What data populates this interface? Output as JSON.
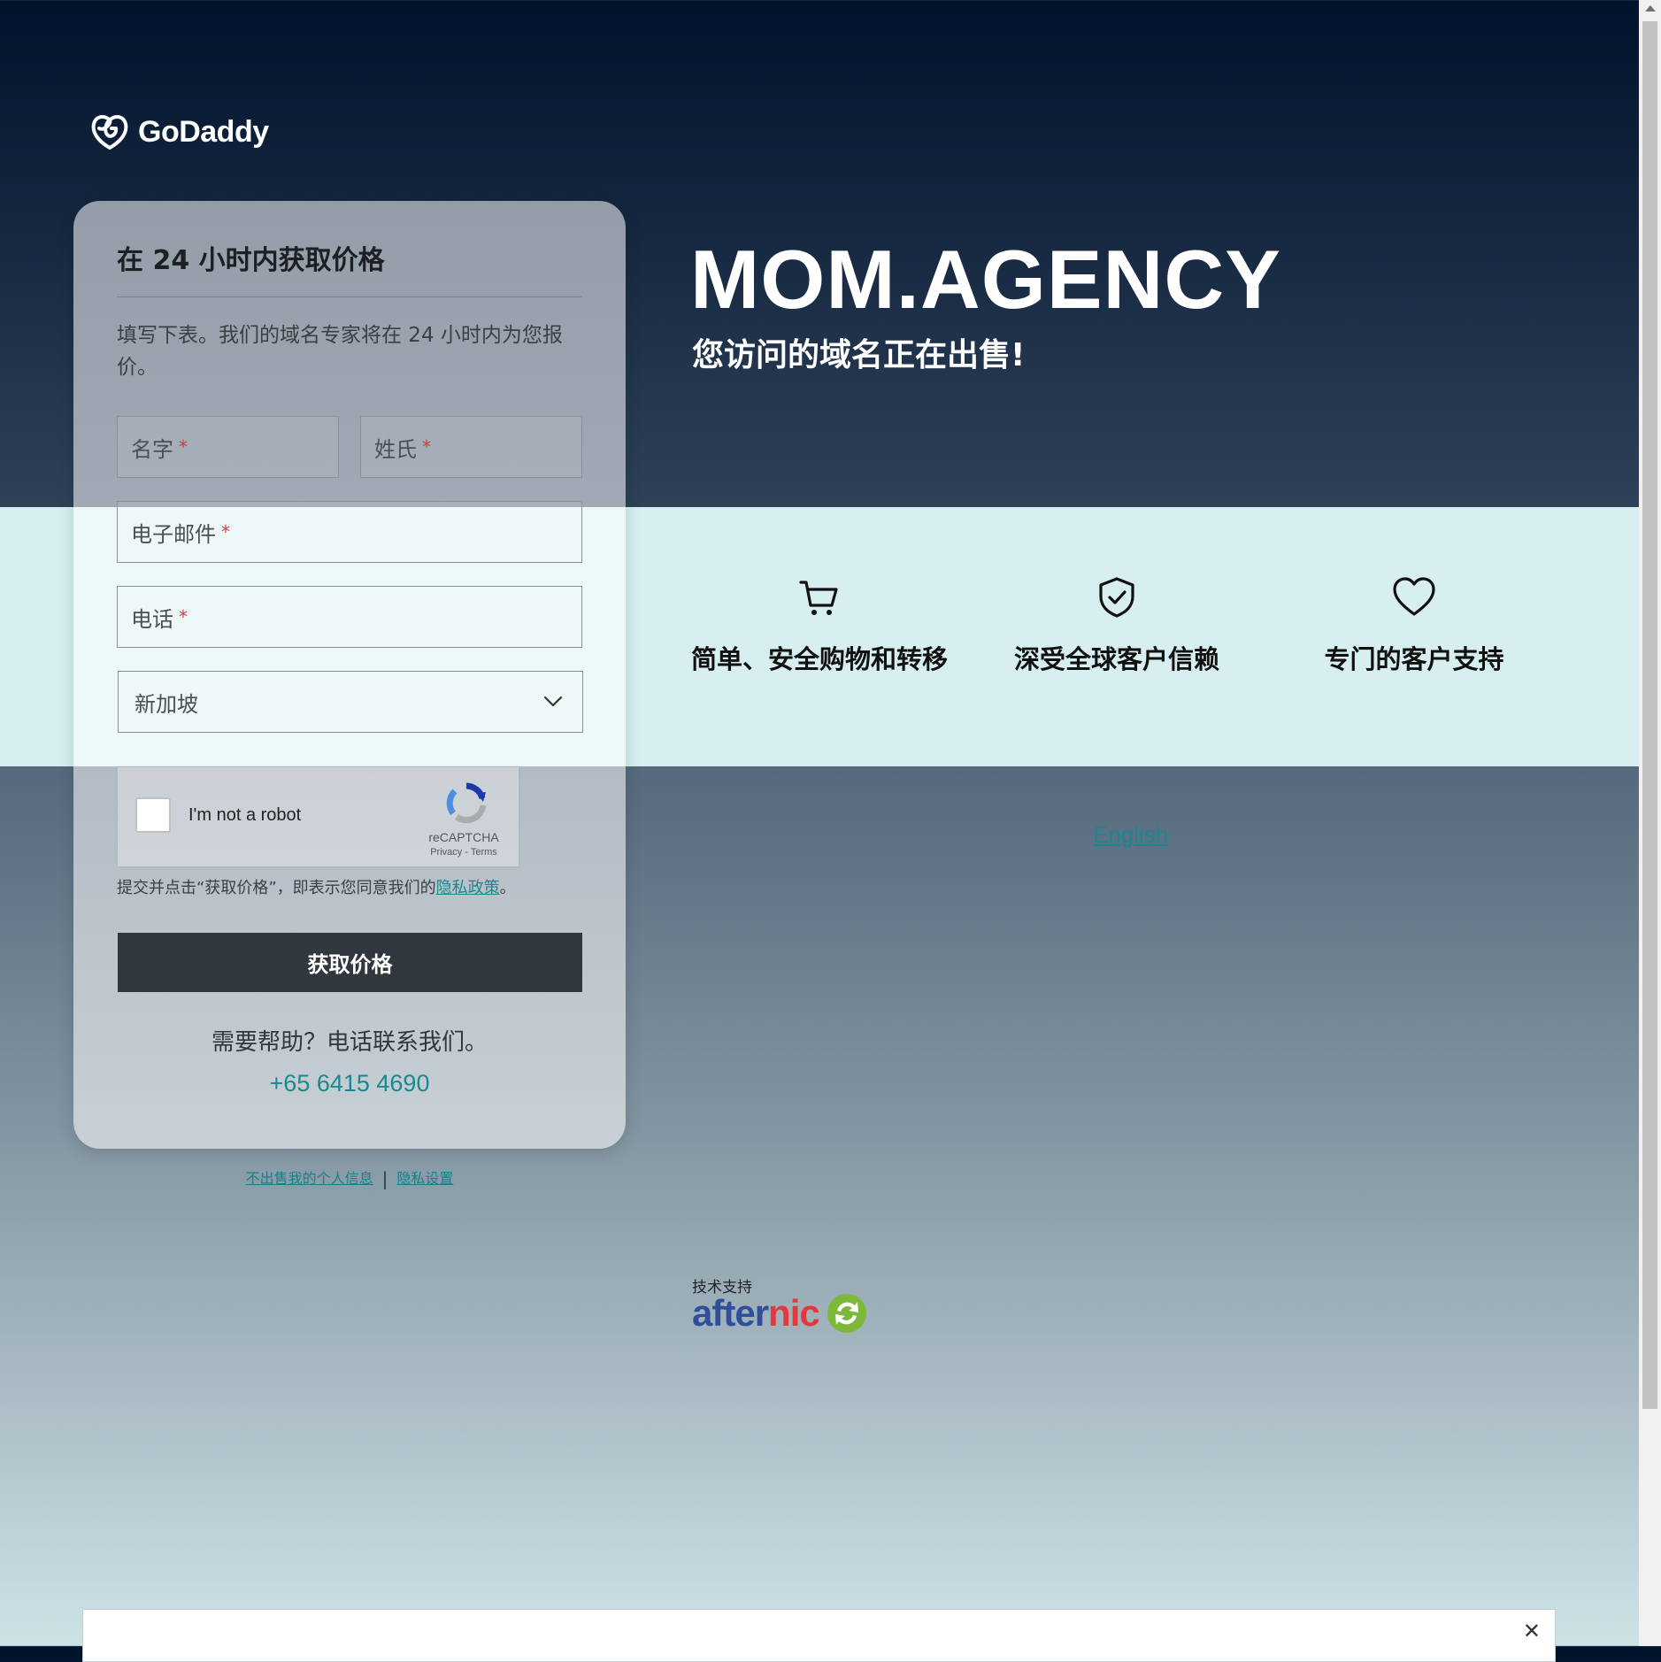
{
  "brand": {
    "name": "GoDaddy"
  },
  "hero": {
    "domain": "MOM.AGENCY",
    "subtitle": "您访问的域名正在出售!"
  },
  "form": {
    "title": "在 24 小时内获取价格",
    "description": "填写下表。我们的域名专家将在 24 小时内为您报价。",
    "fields": {
      "first_name": "名字",
      "last_name": "姓氏",
      "email": "电子邮件",
      "phone": "电话",
      "required_mark": "*"
    },
    "country": "新加坡",
    "captcha": {
      "label": "I'm not a robot",
      "brand": "reCAPTCHA",
      "links": "Privacy - Terms"
    },
    "consent": {
      "prefix": "提交并点击“获取价格”，即表示您同意我们的",
      "link": "隐私政策",
      "suffix": "。"
    },
    "submit_label": "获取价格",
    "help_text": "需要帮助？电话联系我们。",
    "phone_number": "+65 6415 4690"
  },
  "features": [
    {
      "icon": "cart-icon",
      "label": "简单、安全购物和转移"
    },
    {
      "icon": "shield-check-icon",
      "label": "深受全球客户信赖"
    },
    {
      "icon": "heart-icon",
      "label": "专门的客户支持"
    }
  ],
  "language_link": "English",
  "privacy_links": {
    "do_not_sell": "不出售我的个人信息",
    "separator": "|",
    "settings": "隐私设置"
  },
  "powered_by": {
    "label": "技术支持",
    "brand_part1": "after",
    "brand_part2": "nic"
  },
  "banner": {
    "close": "✕"
  },
  "colors": {
    "accent_link": "#17898f",
    "button_dark": "#31373f",
    "band": "#d7eff0",
    "required": "#d03a3a"
  }
}
